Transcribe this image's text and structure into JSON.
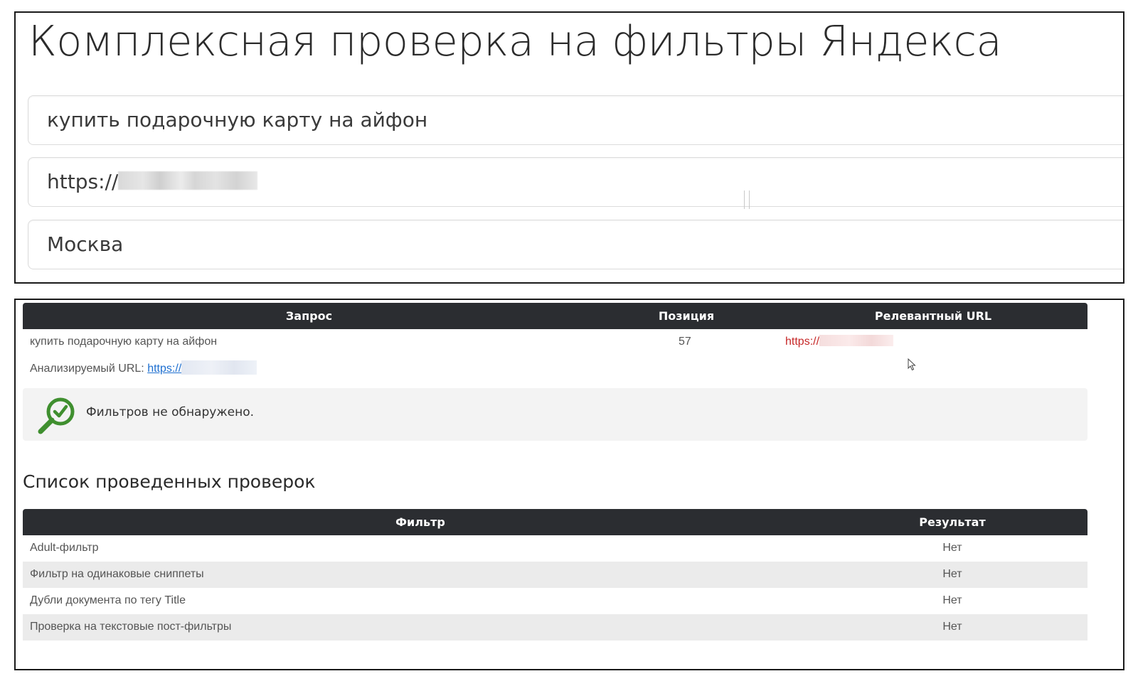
{
  "form": {
    "title": "Комплексная проверка на фильтры Яндекса",
    "query_value": "купить подарочную карту на айфон",
    "url_prefix": "https://",
    "region_value": "Москва"
  },
  "results": {
    "headers": {
      "query": "Запрос",
      "position": "Позиция",
      "relevant_url": "Релевантный URL"
    },
    "row": {
      "query": "купить подарочную карту на айфон",
      "position": "57",
      "relevant_url_prefix": "https://"
    },
    "analyzed_label": "Анализируемый URL:",
    "analyzed_url_prefix": "https://",
    "status_message": "Фильтров не обнаружено.",
    "status_icon": "magnifier-check-icon",
    "status_color": "#3f8f2f"
  },
  "checks": {
    "heading": "Список проведенных проверок",
    "headers": {
      "filter": "Фильтр",
      "result": "Результат"
    },
    "rows": [
      {
        "filter": "Adult-фильтр",
        "result": "Нет"
      },
      {
        "filter": "Фильтр на одинаковые сниппеты",
        "result": "Нет"
      },
      {
        "filter": "Дубли документа по тегу Title",
        "result": "Нет"
      },
      {
        "filter": "Проверка на текстовые пост-фильтры",
        "result": "Нет"
      }
    ]
  },
  "colors": {
    "header_bg": "#2b2d31",
    "link_red": "#c62828",
    "link_blue": "#1e6fd0",
    "stripe": "#ebebeb"
  }
}
